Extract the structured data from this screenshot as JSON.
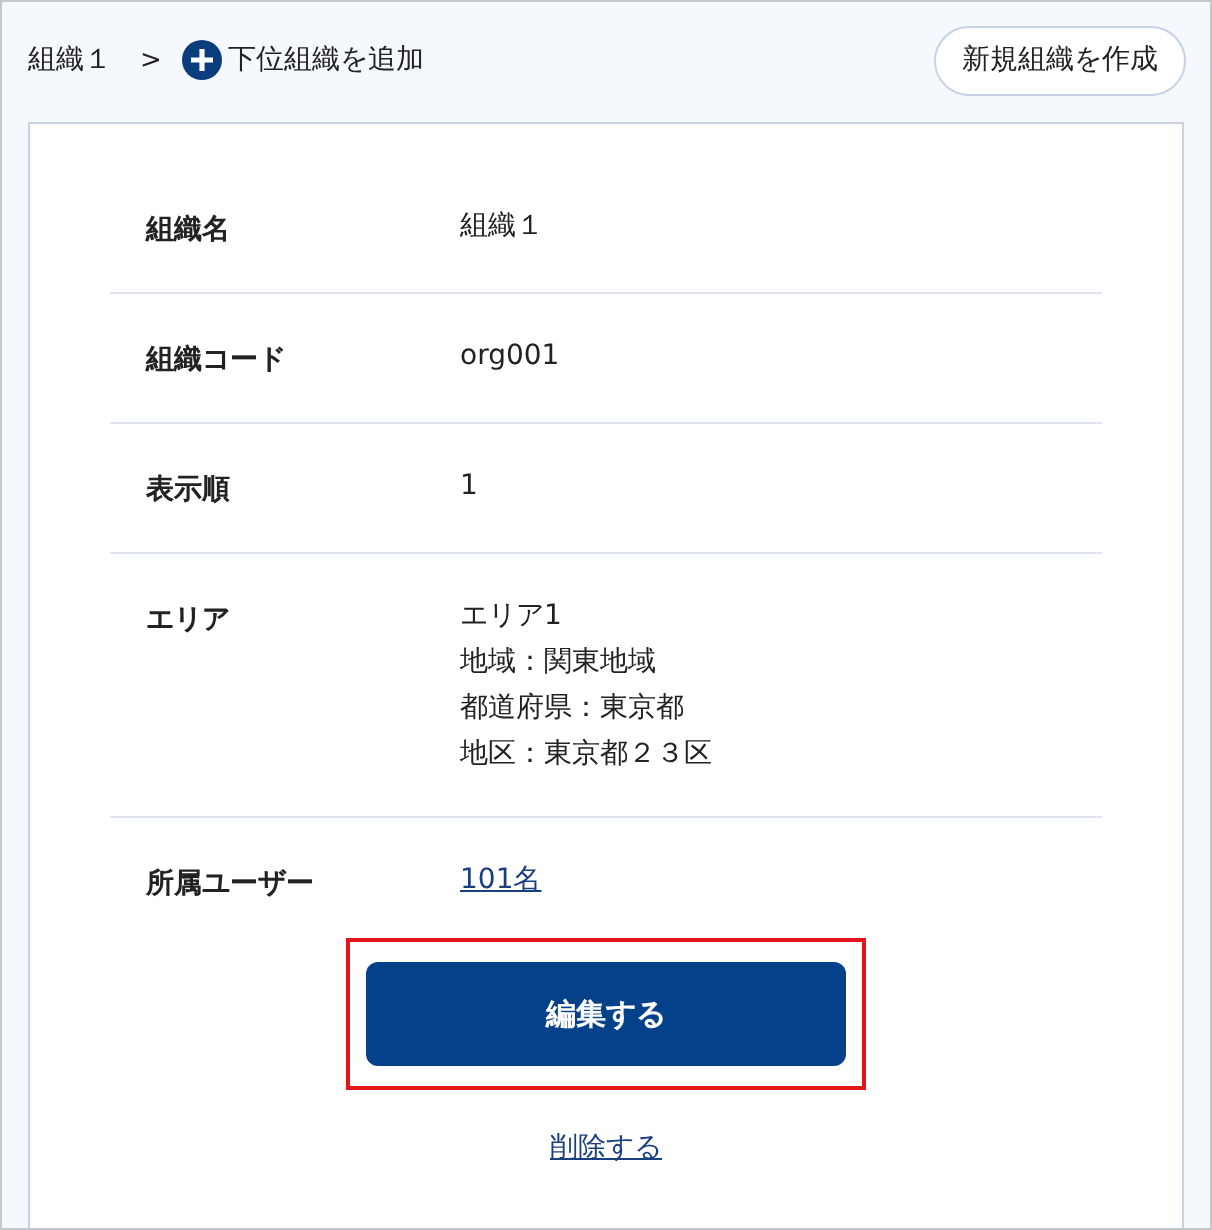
{
  "breadcrumb": {
    "current": "組織１",
    "separator": ">",
    "add_child": "下位組織を追加"
  },
  "create_button": "新規組織を作成",
  "fields": [
    {
      "label": "組織名",
      "kind": "text",
      "lines": [
        "組織１"
      ]
    },
    {
      "label": "組織コード",
      "kind": "text",
      "lines": [
        "org001"
      ]
    },
    {
      "label": "表示順",
      "kind": "text",
      "lines": [
        "1"
      ]
    },
    {
      "label": "エリア",
      "kind": "text",
      "lines": [
        "エリア1",
        "地域：関東地域",
        "都道府県：東京都",
        "地区：東京都２３区"
      ]
    },
    {
      "label": "所属ユーザー",
      "kind": "link",
      "lines": [
        "101名"
      ]
    }
  ],
  "edit_button": {
    "label": "編集する",
    "highlighted": true
  },
  "delete_link": "削除する"
}
